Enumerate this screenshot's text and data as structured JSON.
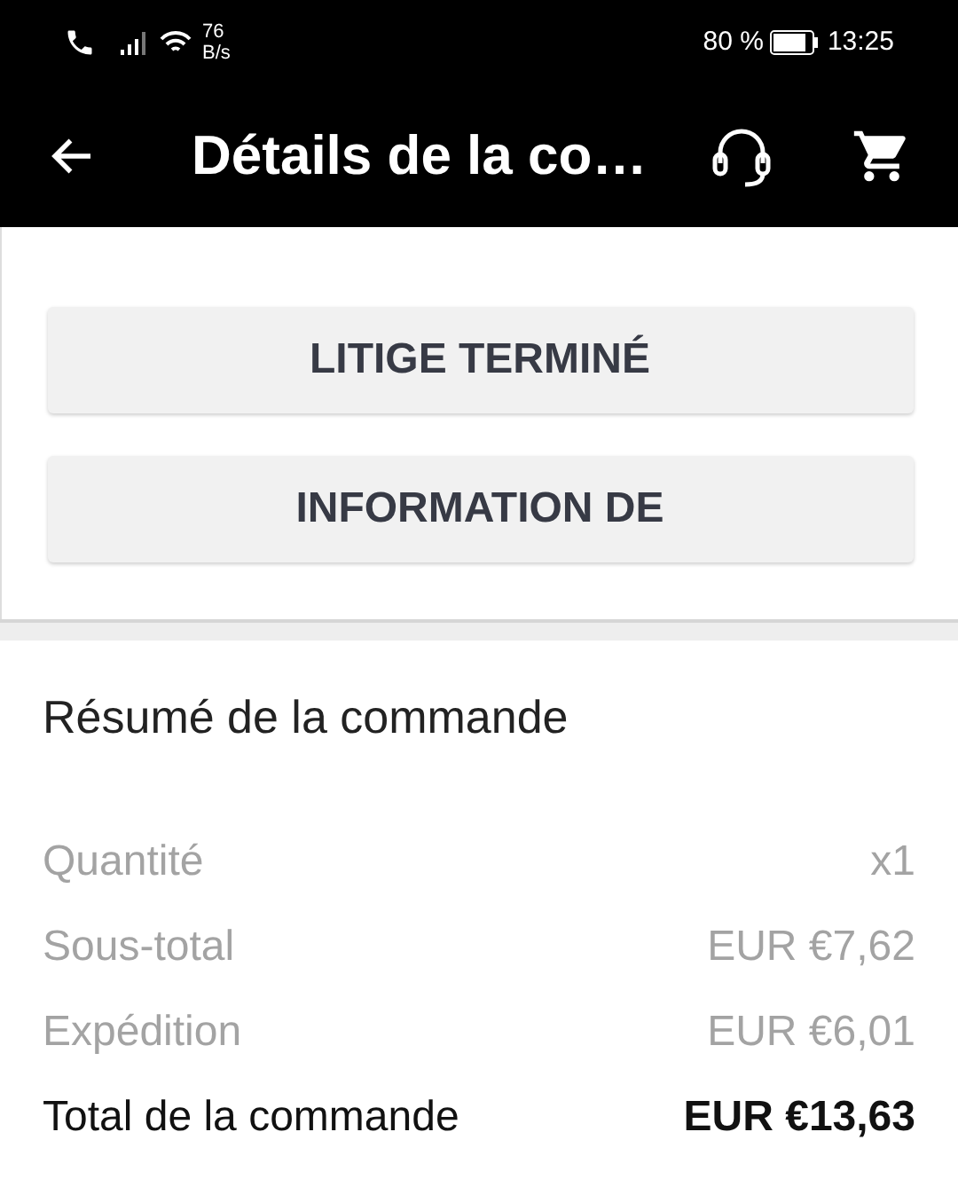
{
  "status_bar": {
    "network_speed": "76",
    "network_speed_unit": "B/s",
    "battery": "80 %",
    "time": "13:25"
  },
  "app_bar": {
    "title": "Détails de la co…"
  },
  "actions": [
    "LITIGE TERMINÉ",
    "INFORMATION DE"
  ],
  "summary": {
    "title": "Résumé de la commande",
    "rows": [
      {
        "kind": "detail",
        "label": "Quantité",
        "value": "x1"
      },
      {
        "kind": "detail",
        "label": "Sous-total",
        "value": "EUR €7,62"
      },
      {
        "kind": "detail",
        "label": "Expédition",
        "value": "EUR €6,01"
      },
      {
        "kind": "total",
        "label": "Total de la commande",
        "value": "EUR €13,63"
      }
    ]
  }
}
